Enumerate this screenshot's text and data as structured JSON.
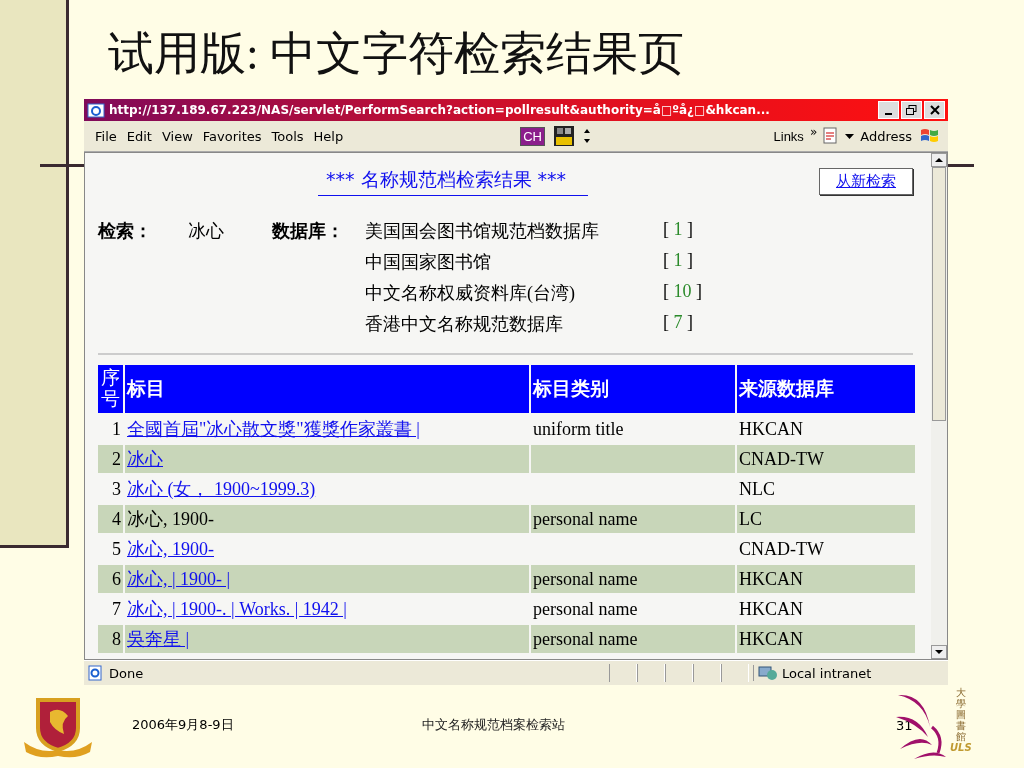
{
  "slide": {
    "title": "试用版: 中文字符检索结果页"
  },
  "browser": {
    "title": "http://137.189.67.223/NAS/servlet/PerformSearch?action=pollresult&authority=å□ºå¿□&hkcan...",
    "menu": [
      "File",
      "Edit",
      "View",
      "Favorites",
      "Tools",
      "Help"
    ],
    "toolbar": {
      "ch": "CH",
      "links": "Links",
      "chevron": "»",
      "address": "Address"
    },
    "page": {
      "heading": "*** 名称规范档检索结果 ***",
      "new_search_button": "从新检索",
      "query_label": "检索：",
      "query": "冰心",
      "db_label": "数据库：",
      "databases": [
        {
          "name": "美国国会图书馆规范档数据库",
          "open": "[",
          "count": "1",
          "close": "]"
        },
        {
          "name": "中国国家图书馆",
          "open": "[",
          "count": "1",
          "close": "]"
        },
        {
          "name": "中文名称权威资料库(台湾)",
          "open": "[",
          "count": "10",
          "close": "]"
        },
        {
          "name": "香港中文名称规范数据库",
          "open": "[",
          "count": "7",
          "close": "]"
        }
      ],
      "table": {
        "columns": [
          "序号",
          "标目",
          "标目类别",
          "来源数据库"
        ],
        "rows": [
          {
            "number": "1",
            "heading": "全國首屆\"冰心散文獎\"獲獎作家叢書 |",
            "link": true,
            "type": "uniform title",
            "source": "HKCAN"
          },
          {
            "number": "2",
            "heading": "冰心",
            "link": true,
            "source": "CNAD-TW"
          },
          {
            "number": "3",
            "heading": "冰心 (女， 1900~1999.3)",
            "link": true,
            "source": "NLC"
          },
          {
            "number": "4",
            "heading": "冰心, 1900-",
            "link": false,
            "type": "personal name",
            "source": "LC"
          },
          {
            "number": "5",
            "heading": "冰心, 1900-",
            "link": true,
            "source": "CNAD-TW"
          },
          {
            "number": "6",
            "heading": "冰心, | 1900- |",
            "link": true,
            "type": "personal name",
            "source": "HKCAN"
          },
          {
            "number": "7",
            "heading": "冰心, | 1900-. | Works. | 1942 |",
            "link": true,
            "type": "personal name",
            "source": "HKCAN"
          },
          {
            "number": "8",
            "heading": "吳奔星 |",
            "link": true,
            "type": "personal name",
            "source": "HKCAN"
          }
        ]
      }
    },
    "status_bar": {
      "text": "Done",
      "zone": "Local intranet"
    }
  },
  "footer": {
    "date": "2006年9月8-9日",
    "title": "中文名称规范档案检索站",
    "page": "31",
    "library_name": "大學圖書館",
    "library_abbr": "ULS"
  }
}
